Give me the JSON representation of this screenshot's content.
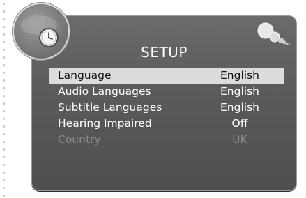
{
  "screen": {
    "title": "SETUP"
  },
  "menu": {
    "items": [
      {
        "label": "Language",
        "value": "English",
        "state": "selected"
      },
      {
        "label": "Audio Languages",
        "value": "English",
        "state": "normal"
      },
      {
        "label": "Subtitle Languages",
        "value": "English",
        "state": "normal"
      },
      {
        "label": "Hearing Impaired",
        "value": "Off",
        "state": "normal"
      },
      {
        "label": "Country",
        "value": "UK",
        "state": "disabled"
      }
    ]
  },
  "icons": {
    "top_left": "clock-icon",
    "top_right": "globe-bubbles-icon"
  },
  "colors": {
    "panel": "#5a5a5a",
    "selected_row": "#dcdcdc",
    "text": "#ffffff",
    "disabled_text": "#8c8c8c"
  }
}
